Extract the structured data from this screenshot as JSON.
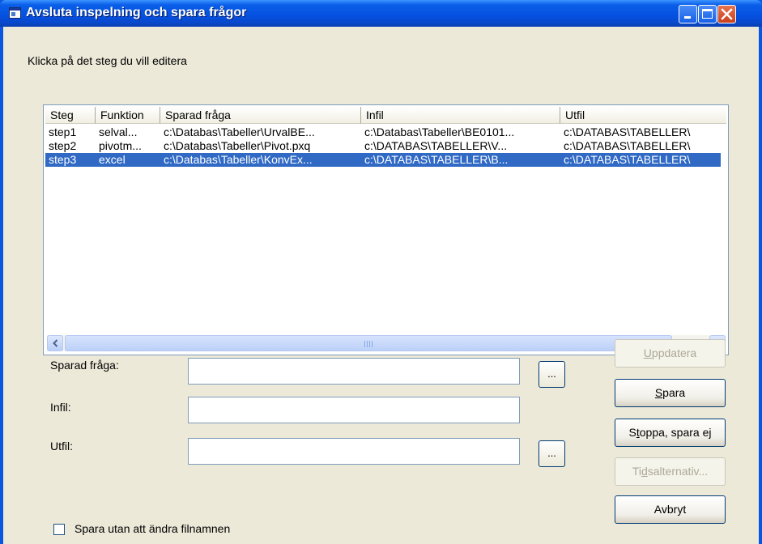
{
  "window": {
    "title": "Avsluta inspelning och spara frågor"
  },
  "instruction": "Klicka på det steg du vill editera",
  "list": {
    "columns": [
      "Steg",
      "Funktion",
      "Sparad fråga",
      "Infil",
      "Utfil"
    ],
    "rows": [
      [
        "step1",
        "selval...",
        "c:\\Databas\\Tabeller\\UrvalBE...",
        "c:\\Databas\\Tabeller\\BE0101...",
        "c:\\DATABAS\\TABELLER\\"
      ],
      [
        "step2",
        "pivotm...",
        "c:\\Databas\\Tabeller\\Pivot.pxq",
        "c:\\DATABAS\\TABELLER\\V...",
        "c:\\DATABAS\\TABELLER\\"
      ],
      [
        "step3",
        "excel",
        "c:\\Databas\\Tabeller\\KonvEx...",
        "c:\\DATABAS\\TABELLER\\B...",
        "c:\\DATABAS\\TABELLER\\"
      ]
    ],
    "selected_row": 2
  },
  "fields": {
    "sparad_fraga": {
      "label": "Sparad fråga:",
      "value": ""
    },
    "infil": {
      "label": "Infil:",
      "value": ""
    },
    "utfil": {
      "label": "Utfil:",
      "value": ""
    },
    "browse_label": "..."
  },
  "buttons": {
    "uppdatera": {
      "pre": "",
      "key": "U",
      "post": "ppdatera"
    },
    "spara": {
      "pre": "",
      "key": "S",
      "post": "para"
    },
    "stoppa": {
      "pre": "S",
      "key": "t",
      "post": "oppa, spara ej"
    },
    "tidsalternativ": {
      "pre": "Ti",
      "key": "d",
      "post": "salternativ..."
    },
    "avbryt": {
      "pre": "Avbryt",
      "key": "",
      "post": ""
    }
  },
  "checkbox": {
    "label": "Spara utan att ändra filnamnen",
    "checked": false
  },
  "colors": {
    "selection": "#316ac5",
    "titlebar": "#0550e0",
    "face": "#ece9d8"
  }
}
